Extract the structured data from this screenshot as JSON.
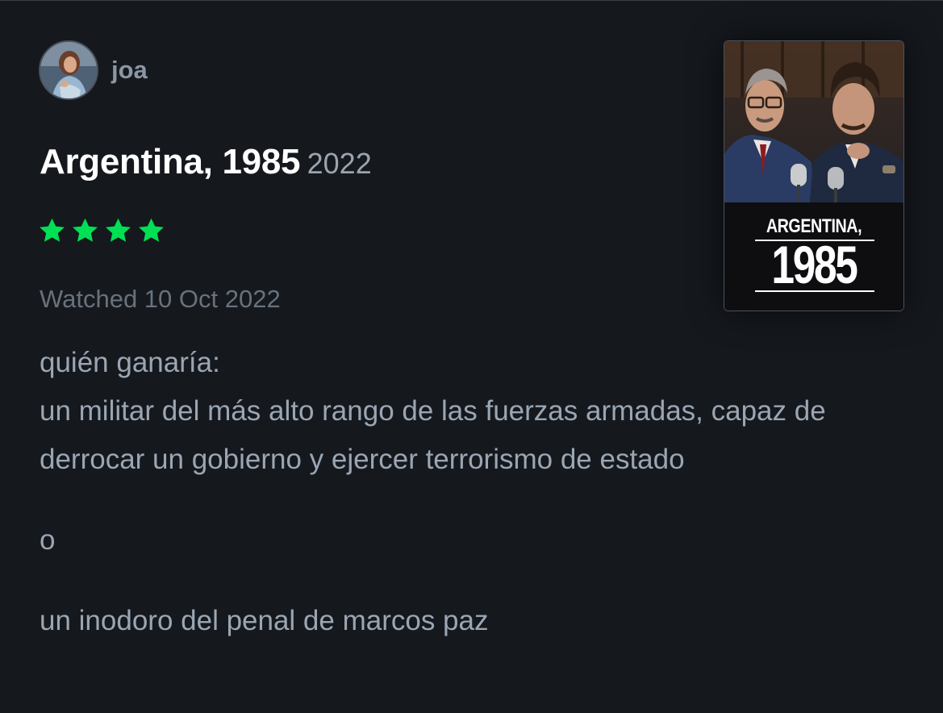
{
  "author": {
    "name": "joa",
    "avatar_icon": "user-avatar"
  },
  "film": {
    "title": "Argentina, 1985",
    "year": "2022",
    "poster": {
      "line1": "ARGENTINA,",
      "line2": "1985"
    }
  },
  "rating": {
    "stars": 4,
    "max": 5,
    "color": "#00e054"
  },
  "watched": "Watched 10 Oct 2022",
  "review": {
    "paragraphs": [
      "quién ganaría:",
      "un militar del más alto rango de las fuerzas armadas, capaz de derrocar un gobierno y ejercer terrorismo de estado",
      "o",
      "un inodoro del penal de marcos paz"
    ]
  },
  "colors": {
    "background": "#15181d",
    "title": "#ffffff",
    "body_text": "#9aa6b3",
    "muted": "#68727d"
  }
}
